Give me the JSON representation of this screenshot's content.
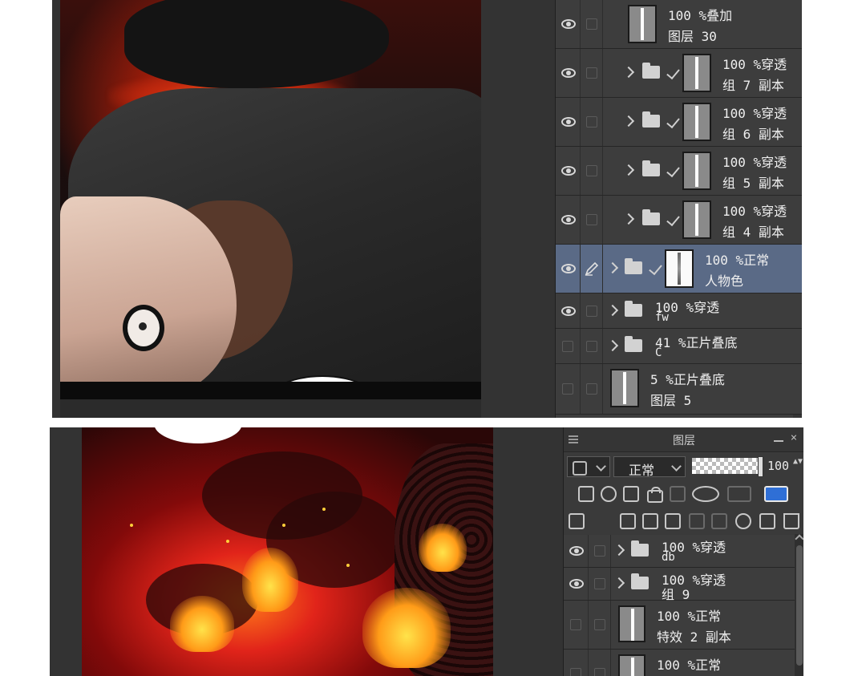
{
  "top_panel": {
    "layers": [
      {
        "opacity": "100 %",
        "mode": "叠加",
        "name": "图层 30",
        "eye": true,
        "folder": false,
        "check": false
      },
      {
        "opacity": "100 %",
        "mode": "穿透",
        "name": "组 7 副本",
        "eye": true,
        "folder": true,
        "check": true
      },
      {
        "opacity": "100 %",
        "mode": "穿透",
        "name": "组 6 副本",
        "eye": true,
        "folder": true,
        "check": true
      },
      {
        "opacity": "100 %",
        "mode": "穿透",
        "name": "组 5 副本",
        "eye": true,
        "folder": true,
        "check": true
      },
      {
        "opacity": "100 %",
        "mode": "穿透",
        "name": "组 4 副本",
        "eye": true,
        "folder": true,
        "check": true
      },
      {
        "opacity": "100 %",
        "mode": "正常",
        "name": "人物色",
        "eye": true,
        "folder": true,
        "check": true,
        "selected": true
      },
      {
        "opacity": "100 %",
        "mode": "穿透",
        "name": "fw",
        "eye": true,
        "folder": true,
        "check": false
      },
      {
        "opacity": "41 %",
        "mode": "正片叠底",
        "name": "C",
        "eye": false,
        "folder": true,
        "check": false
      },
      {
        "opacity": "5 %",
        "mode": "正片叠底",
        "name": "图层 5",
        "eye": false,
        "folder": false,
        "check": false
      }
    ]
  },
  "bottom_panel": {
    "title": "图层",
    "close_glyph": "×",
    "blend_mode": "正常",
    "opacity_value": "100",
    "opacity_fraction": 1.0,
    "spin_glyph": "▲▼",
    "layers": [
      {
        "opacity": "100 %",
        "mode": "穿透",
        "name": "db",
        "eye": true,
        "folder": true
      },
      {
        "opacity": "100 %",
        "mode": "穿透",
        "name": "组 9",
        "eye": true,
        "folder": true
      },
      {
        "opacity": "100 %",
        "mode": "正常",
        "name": "特效 2 副本",
        "eye": false,
        "folder": false
      },
      {
        "opacity": "100 %",
        "mode": "正常",
        "name": "",
        "eye": false,
        "folder": false
      }
    ]
  },
  "icons": {
    "visibility": "eye-icon",
    "folder": "folder-icon",
    "expand": "chevron-right-icon",
    "clip": "check-icon",
    "edit": "pen-icon"
  },
  "colors": {
    "panel_bg": "#3d3d3d",
    "selected_row": "#5a6a86",
    "accent_blue": "#2f6fd6"
  }
}
